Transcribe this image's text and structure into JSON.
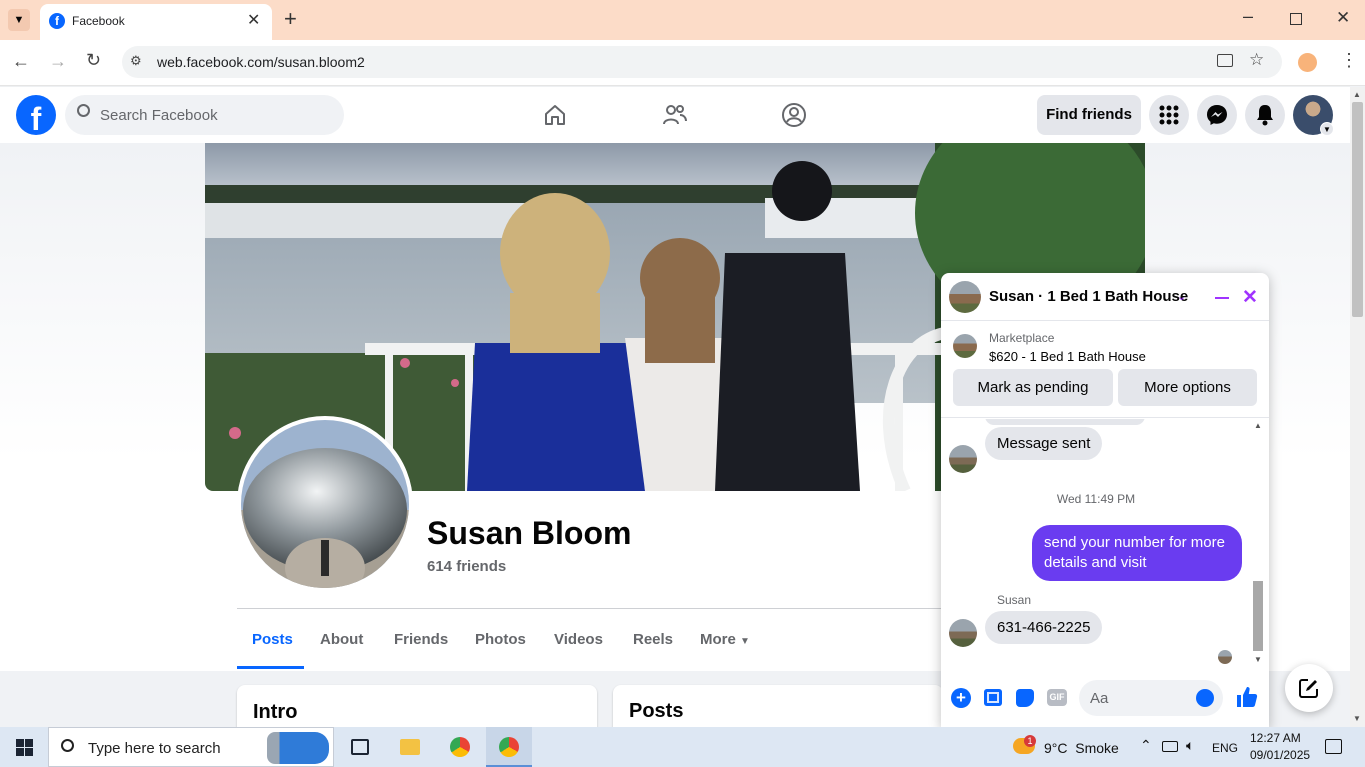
{
  "browser": {
    "tab_title": "Facebook",
    "url": "web.facebook.com/susan.bloom2"
  },
  "fb_header": {
    "search_placeholder": "Search Facebook",
    "find_friends": "Find friends"
  },
  "profile": {
    "name": "Susan Bloom",
    "friends": "614 friends",
    "tabs": [
      "Posts",
      "About",
      "Friends",
      "Photos",
      "Videos",
      "Reels",
      "More"
    ],
    "active_tab": "Posts",
    "intro_title": "Intro",
    "posts_title": "Posts"
  },
  "chat": {
    "title": "Susan · 1 Bed 1 Bath House",
    "marketplace_label": "Marketplace",
    "listing": "$620 - 1 Bed 1 Bath House",
    "mark_pending": "Mark as pending",
    "more_options": "More options",
    "msg_sent": "Message sent",
    "timestamp": "Wed 11:49 PM",
    "outgoing": "send your number for more details and visit",
    "sender_name": "Susan",
    "incoming": "631-466-2225",
    "input_placeholder": "Aa"
  },
  "taskbar": {
    "search_placeholder": "Type here to search",
    "weather": "9°C  Smoke",
    "lang": "ENG",
    "time": "12:27 AM",
    "date": "09/01/2025",
    "weather_badge": "1"
  },
  "colors": {
    "fb_blue": "#0866ff",
    "messenger_purple": "#a033ff",
    "outgoing_bubble": "#6a3cf0"
  }
}
